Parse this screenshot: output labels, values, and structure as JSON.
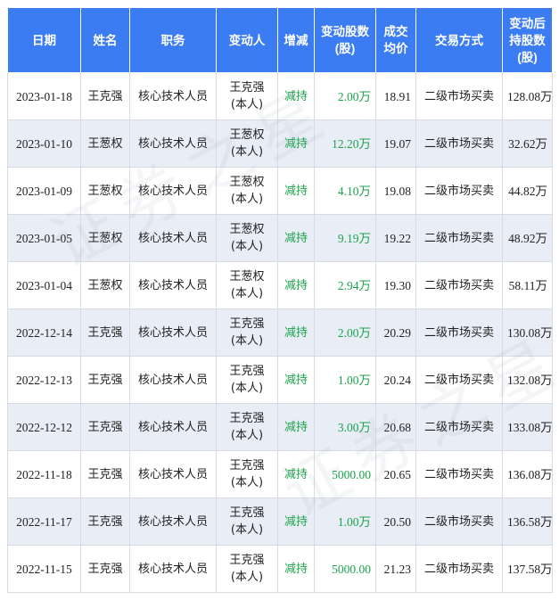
{
  "headers": [
    "日期",
    "姓名",
    "职务",
    "变动人",
    "增减",
    "变动股数\n(股)",
    "成交\n均价",
    "交易方式",
    "变动后\n持股数\n(股)"
  ],
  "rows": [
    {
      "date": "2023-01-18",
      "name": "王克强",
      "role": "核心技术人员",
      "person": "王克强\n(本人)",
      "dir": "减持",
      "shares": "2.00万",
      "price": "18.91",
      "method": "二级市场买卖",
      "after": "128.08万"
    },
    {
      "date": "2023-01-10",
      "name": "王葱权",
      "role": "核心技术人员",
      "person": "王葱权\n(本人)",
      "dir": "减持",
      "shares": "12.20万",
      "price": "19.07",
      "method": "二级市场买卖",
      "after": "32.62万"
    },
    {
      "date": "2023-01-09",
      "name": "王葱权",
      "role": "核心技术人员",
      "person": "王葱权\n(本人)",
      "dir": "减持",
      "shares": "4.10万",
      "price": "19.08",
      "method": "二级市场买卖",
      "after": "44.82万"
    },
    {
      "date": "2023-01-05",
      "name": "王葱权",
      "role": "核心技术人员",
      "person": "王葱权\n(本人)",
      "dir": "减持",
      "shares": "9.19万",
      "price": "19.22",
      "method": "二级市场买卖",
      "after": "48.92万"
    },
    {
      "date": "2023-01-04",
      "name": "王葱权",
      "role": "核心技术人员",
      "person": "王葱权\n(本人)",
      "dir": "减持",
      "shares": "2.94万",
      "price": "19.30",
      "method": "二级市场买卖",
      "after": "58.11万"
    },
    {
      "date": "2022-12-14",
      "name": "王克强",
      "role": "核心技术人员",
      "person": "王克强\n(本人)",
      "dir": "减持",
      "shares": "2.00万",
      "price": "20.29",
      "method": "二级市场买卖",
      "after": "130.08万"
    },
    {
      "date": "2022-12-13",
      "name": "王克强",
      "role": "核心技术人员",
      "person": "王克强\n(本人)",
      "dir": "减持",
      "shares": "1.00万",
      "price": "20.24",
      "method": "二级市场买卖",
      "after": "132.08万"
    },
    {
      "date": "2022-12-12",
      "name": "王克强",
      "role": "核心技术人员",
      "person": "王克强\n(本人)",
      "dir": "减持",
      "shares": "3.00万",
      "price": "20.68",
      "method": "二级市场买卖",
      "after": "133.08万"
    },
    {
      "date": "2022-11-18",
      "name": "王克强",
      "role": "核心技术人员",
      "person": "王克强\n(本人)",
      "dir": "减持",
      "shares": "5000.00",
      "price": "20.65",
      "method": "二级市场买卖",
      "after": "136.08万"
    },
    {
      "date": "2022-11-17",
      "name": "王克强",
      "role": "核心技术人员",
      "person": "王克强\n(本人)",
      "dir": "减持",
      "shares": "1.00万",
      "price": "20.50",
      "method": "二级市场买卖",
      "after": "136.58万"
    },
    {
      "date": "2022-11-15",
      "name": "王克强",
      "role": "核心技术人员",
      "person": "王克强\n(本人)",
      "dir": "减持",
      "shares": "5000.00",
      "price": "21.23",
      "method": "二级市场买卖",
      "after": "137.58万"
    }
  ],
  "watermark": "证券之星",
  "colors": {
    "header_bg": "#3c7cf2",
    "row_alt": "#e9edf6",
    "decrease": "#1aa34a"
  }
}
